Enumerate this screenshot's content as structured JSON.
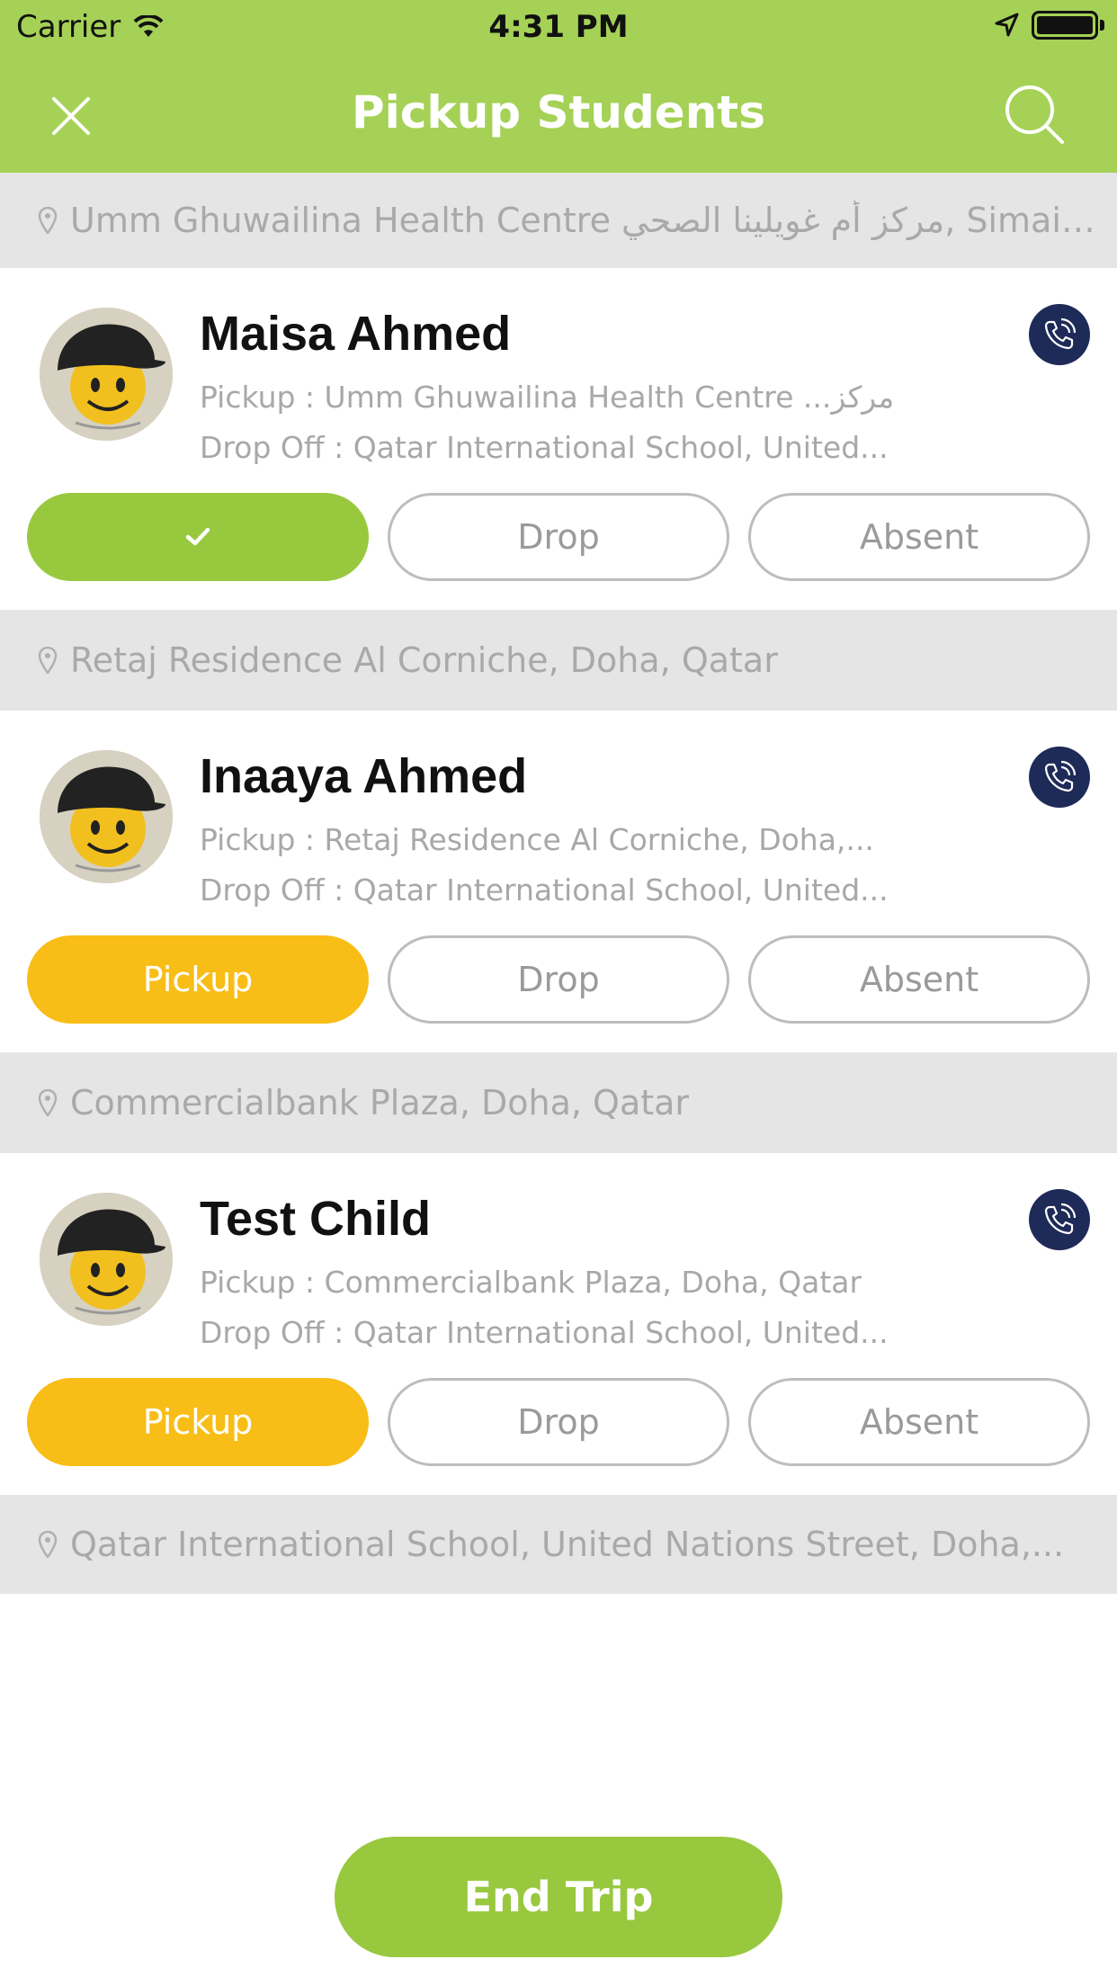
{
  "status_bar": {
    "carrier": "Carrier",
    "time": "4:31 PM"
  },
  "nav": {
    "title": "Pickup Students"
  },
  "stops": [
    {
      "address": "Umm Ghuwailina Health Centre مركز أم غويلينا الصحي, Simais...",
      "student": {
        "name": "Maisa Ahmed",
        "pickup": "Pickup : Umm Ghuwailina Health Centre ...مركز",
        "dropoff": "Drop Off : Qatar International School, United...",
        "primary_state": "done",
        "primary_label": "",
        "drop_label": "Drop",
        "absent_label": "Absent"
      }
    },
    {
      "address": "Retaj Residence Al Corniche, Doha, Qatar",
      "student": {
        "name": "Inaaya Ahmed",
        "pickup": "Pickup : Retaj Residence Al Corniche, Doha,...",
        "dropoff": "Drop Off : Qatar International School, United...",
        "primary_state": "pickup",
        "primary_label": "Pickup",
        "drop_label": "Drop",
        "absent_label": "Absent"
      }
    },
    {
      "address": "Commercialbank Plaza, Doha, Qatar",
      "student": {
        "name": "Test Child",
        "pickup": "Pickup : Commercialbank Plaza, Doha, Qatar",
        "dropoff": "Drop Off : Qatar International School, United...",
        "primary_state": "pickup",
        "primary_label": "Pickup",
        "drop_label": "Drop",
        "absent_label": "Absent"
      }
    },
    {
      "address": "Qatar International School, United Nations Street, Doha,..."
    }
  ],
  "footer": {
    "end_trip_label": "End Trip"
  },
  "colors": {
    "header": "#a5d156",
    "done_button": "#98c83e",
    "pickup_button": "#f8bd16",
    "call_button": "#1e2a57",
    "address_bar": "#e5e5e5"
  }
}
